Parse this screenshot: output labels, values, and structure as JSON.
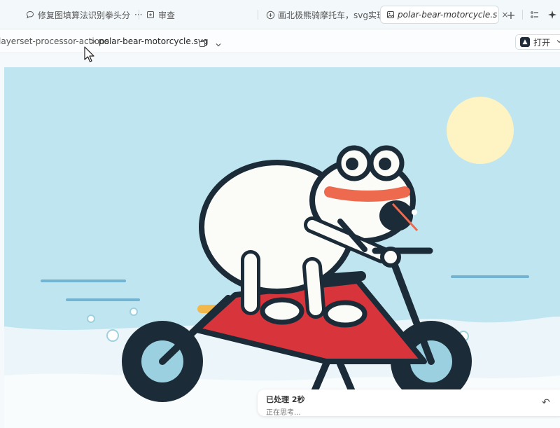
{
  "tabs": {
    "chat_tab_label": "修复图填算法识别拳头分",
    "more_label": "···",
    "review_tab_label": "审查",
    "prompt_tab_label": "画北极熊骑摩托车，svg实现",
    "file_tab_label": "polar-bear-motorcycle.s"
  },
  "toolbar": {
    "add_label": "+",
    "close_label": "×"
  },
  "path": {
    "parent": "layerset-processor-actions",
    "separator": ">",
    "file": "polar-bear-motorcycle.svg",
    "open_label": "打开"
  },
  "status": {
    "title": "已处理 2秒",
    "subtitle": "正在思考...",
    "undo_label": "↶"
  },
  "colors": {
    "sky": "#bfe5f0",
    "sun": "#fdf3c3",
    "snow": "#f4fafc",
    "bear": "#fbfbf8",
    "outline": "#1c2b38",
    "bike_red": "#d7353b",
    "scarf": "#ee6a4f",
    "wheel_hub": "#9ad0df",
    "speed_line": "#72b4d2",
    "pipe": "#f2b84b"
  }
}
